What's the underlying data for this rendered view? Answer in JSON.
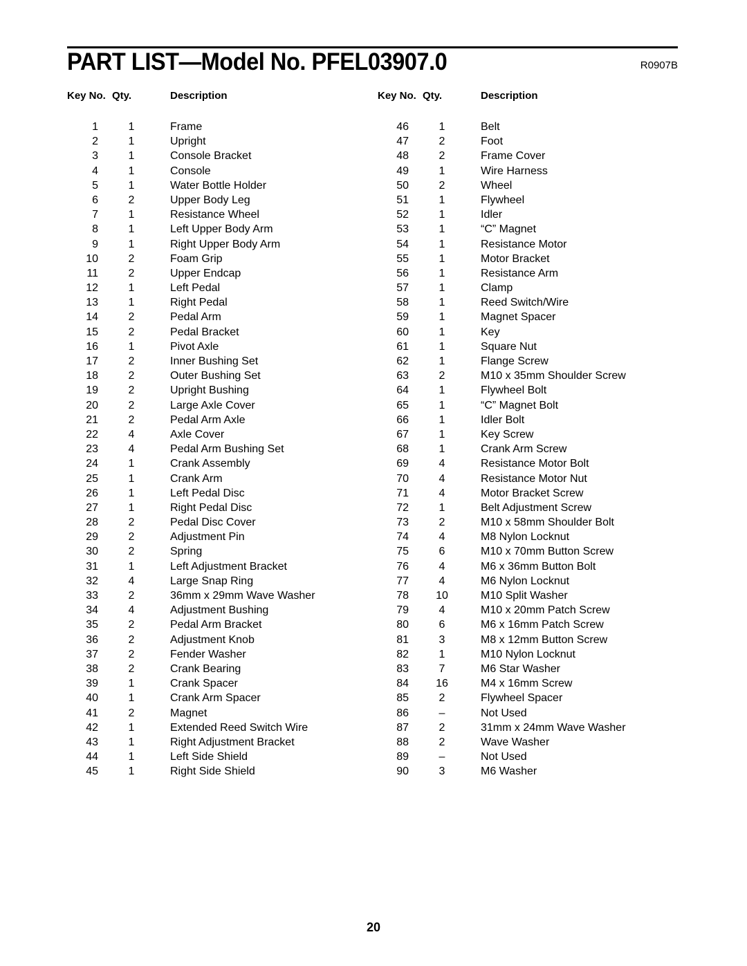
{
  "header": {
    "title": "PART LIST—Model No. PFEL03907.0",
    "revision": "R0907B"
  },
  "columns": {
    "key_label": "Key No.",
    "qty_label": "Qty.",
    "desc_label": "Description"
  },
  "parts_left": [
    {
      "key": "1",
      "qty": "1",
      "desc": "Frame"
    },
    {
      "key": "2",
      "qty": "1",
      "desc": "Upright"
    },
    {
      "key": "3",
      "qty": "1",
      "desc": "Console Bracket"
    },
    {
      "key": "4",
      "qty": "1",
      "desc": "Console"
    },
    {
      "key": "5",
      "qty": "1",
      "desc": "Water Bottle Holder"
    },
    {
      "key": "6",
      "qty": "2",
      "desc": "Upper Body Leg"
    },
    {
      "key": "7",
      "qty": "1",
      "desc": "Resistance Wheel"
    },
    {
      "key": "8",
      "qty": "1",
      "desc": "Left Upper Body Arm"
    },
    {
      "key": "9",
      "qty": "1",
      "desc": "Right Upper Body Arm"
    },
    {
      "key": "10",
      "qty": "2",
      "desc": "Foam Grip"
    },
    {
      "key": "11",
      "qty": "2",
      "desc": "Upper Endcap"
    },
    {
      "key": "12",
      "qty": "1",
      "desc": "Left Pedal"
    },
    {
      "key": "13",
      "qty": "1",
      "desc": "Right Pedal"
    },
    {
      "key": "14",
      "qty": "2",
      "desc": "Pedal Arm"
    },
    {
      "key": "15",
      "qty": "2",
      "desc": "Pedal Bracket"
    },
    {
      "key": "16",
      "qty": "1",
      "desc": "Pivot Axle"
    },
    {
      "key": "17",
      "qty": "2",
      "desc": "Inner Bushing Set"
    },
    {
      "key": "18",
      "qty": "2",
      "desc": "Outer Bushing Set"
    },
    {
      "key": "19",
      "qty": "2",
      "desc": "Upright Bushing"
    },
    {
      "key": "20",
      "qty": "2",
      "desc": "Large Axle Cover"
    },
    {
      "key": "21",
      "qty": "2",
      "desc": "Pedal Arm Axle"
    },
    {
      "key": "22",
      "qty": "4",
      "desc": "Axle Cover"
    },
    {
      "key": "23",
      "qty": "4",
      "desc": "Pedal Arm Bushing Set"
    },
    {
      "key": "24",
      "qty": "1",
      "desc": "Crank Assembly"
    },
    {
      "key": "25",
      "qty": "1",
      "desc": "Crank Arm"
    },
    {
      "key": "26",
      "qty": "1",
      "desc": "Left Pedal Disc"
    },
    {
      "key": "27",
      "qty": "1",
      "desc": "Right Pedal Disc"
    },
    {
      "key": "28",
      "qty": "2",
      "desc": "Pedal Disc Cover"
    },
    {
      "key": "29",
      "qty": "2",
      "desc": "Adjustment Pin"
    },
    {
      "key": "30",
      "qty": "2",
      "desc": "Spring"
    },
    {
      "key": "31",
      "qty": "1",
      "desc": "Left Adjustment Bracket"
    },
    {
      "key": "32",
      "qty": "4",
      "desc": "Large Snap Ring"
    },
    {
      "key": "33",
      "qty": "2",
      "desc": "36mm x 29mm Wave Washer"
    },
    {
      "key": "34",
      "qty": "4",
      "desc": "Adjustment Bushing"
    },
    {
      "key": "35",
      "qty": "2",
      "desc": "Pedal Arm Bracket"
    },
    {
      "key": "36",
      "qty": "2",
      "desc": "Adjustment Knob"
    },
    {
      "key": "37",
      "qty": "2",
      "desc": "Fender Washer"
    },
    {
      "key": "38",
      "qty": "2",
      "desc": "Crank Bearing"
    },
    {
      "key": "39",
      "qty": "1",
      "desc": "Crank Spacer"
    },
    {
      "key": "40",
      "qty": "1",
      "desc": "Crank Arm Spacer"
    },
    {
      "key": "41",
      "qty": "2",
      "desc": "Magnet"
    },
    {
      "key": "42",
      "qty": "1",
      "desc": "Extended Reed Switch Wire"
    },
    {
      "key": "43",
      "qty": "1",
      "desc": "Right Adjustment Bracket"
    },
    {
      "key": "44",
      "qty": "1",
      "desc": "Left Side Shield"
    },
    {
      "key": "45",
      "qty": "1",
      "desc": "Right Side Shield"
    }
  ],
  "parts_right": [
    {
      "key": "46",
      "qty": "1",
      "desc": "Belt"
    },
    {
      "key": "47",
      "qty": "2",
      "desc": "Foot"
    },
    {
      "key": "48",
      "qty": "2",
      "desc": "Frame Cover"
    },
    {
      "key": "49",
      "qty": "1",
      "desc": "Wire Harness"
    },
    {
      "key": "50",
      "qty": "2",
      "desc": "Wheel"
    },
    {
      "key": "51",
      "qty": "1",
      "desc": "Flywheel"
    },
    {
      "key": "52",
      "qty": "1",
      "desc": "Idler"
    },
    {
      "key": "53",
      "qty": "1",
      "desc": "“C” Magnet"
    },
    {
      "key": "54",
      "qty": "1",
      "desc": "Resistance Motor"
    },
    {
      "key": "55",
      "qty": "1",
      "desc": "Motor Bracket"
    },
    {
      "key": "56",
      "qty": "1",
      "desc": "Resistance Arm"
    },
    {
      "key": "57",
      "qty": "1",
      "desc": "Clamp"
    },
    {
      "key": "58",
      "qty": "1",
      "desc": "Reed Switch/Wire"
    },
    {
      "key": "59",
      "qty": "1",
      "desc": "Magnet Spacer"
    },
    {
      "key": "60",
      "qty": "1",
      "desc": "Key"
    },
    {
      "key": "61",
      "qty": "1",
      "desc": "Square Nut"
    },
    {
      "key": "62",
      "qty": "1",
      "desc": "Flange Screw"
    },
    {
      "key": "63",
      "qty": "2",
      "desc": "M10 x 35mm Shoulder Screw"
    },
    {
      "key": "64",
      "qty": "1",
      "desc": "Flywheel Bolt"
    },
    {
      "key": "65",
      "qty": "1",
      "desc": "“C” Magnet Bolt"
    },
    {
      "key": "66",
      "qty": "1",
      "desc": "Idler Bolt"
    },
    {
      "key": "67",
      "qty": "1",
      "desc": "Key Screw"
    },
    {
      "key": "68",
      "qty": "1",
      "desc": "Crank Arm Screw"
    },
    {
      "key": "69",
      "qty": "4",
      "desc": "Resistance Motor Bolt"
    },
    {
      "key": "70",
      "qty": "4",
      "desc": "Resistance Motor Nut"
    },
    {
      "key": "71",
      "qty": "4",
      "desc": "Motor Bracket Screw"
    },
    {
      "key": "72",
      "qty": "1",
      "desc": "Belt Adjustment Screw"
    },
    {
      "key": "73",
      "qty": "2",
      "desc": "M10 x 58mm Shoulder Bolt"
    },
    {
      "key": "74",
      "qty": "4",
      "desc": "M8 Nylon Locknut"
    },
    {
      "key": "75",
      "qty": "6",
      "desc": "M10 x 70mm Button Screw"
    },
    {
      "key": "76",
      "qty": "4",
      "desc": "M6 x 36mm Button Bolt"
    },
    {
      "key": "77",
      "qty": "4",
      "desc": "M6 Nylon Locknut"
    },
    {
      "key": "78",
      "qty": "10",
      "desc": "M10 Split Washer"
    },
    {
      "key": "79",
      "qty": "4",
      "desc": "M10 x 20mm Patch Screw"
    },
    {
      "key": "80",
      "qty": "6",
      "desc": "M6 x 16mm Patch Screw"
    },
    {
      "key": "81",
      "qty": "3",
      "desc": "M8 x 12mm Button Screw"
    },
    {
      "key": "82",
      "qty": "1",
      "desc": "M10 Nylon Locknut"
    },
    {
      "key": "83",
      "qty": "7",
      "desc": "M6 Star Washer"
    },
    {
      "key": "84",
      "qty": "16",
      "desc": "M4 x 16mm Screw"
    },
    {
      "key": "85",
      "qty": "2",
      "desc": "Flywheel Spacer"
    },
    {
      "key": "86",
      "qty": "–",
      "desc": "Not Used"
    },
    {
      "key": "87",
      "qty": "2",
      "desc": "31mm x 24mm Wave Washer"
    },
    {
      "key": "88",
      "qty": "2",
      "desc": "Wave Washer"
    },
    {
      "key": "89",
      "qty": "–",
      "desc": "Not Used"
    },
    {
      "key": "90",
      "qty": "3",
      "desc": "M6 Washer"
    }
  ],
  "footer": {
    "page_number": "20"
  }
}
